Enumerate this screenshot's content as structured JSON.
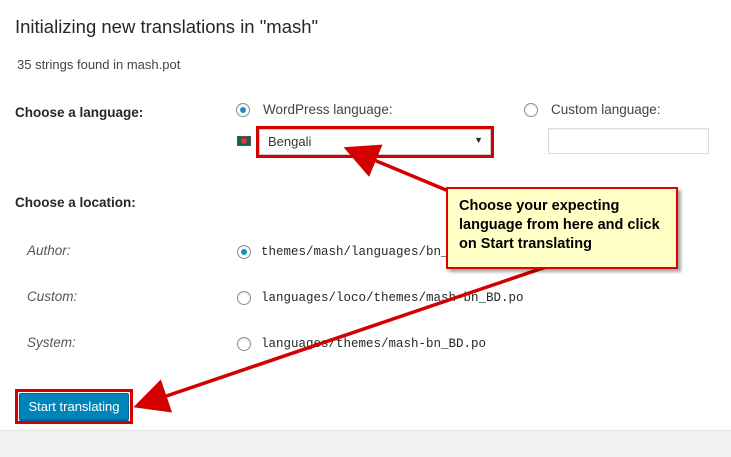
{
  "header": {
    "title": "Initializing new translations in \"mash\"",
    "subtitle": "35 strings found in mash.pot"
  },
  "language": {
    "section_label": "Choose a language:",
    "wordpress_option": "WordPress language:",
    "custom_option": "Custom language:",
    "selected_language": "Bengali",
    "flag_icon": "bangladesh-flag-icon",
    "custom_value": ""
  },
  "location": {
    "section_label": "Choose a location:",
    "options": [
      {
        "label": "Author:",
        "path": "themes/mash/languages/bn_B",
        "checked": true
      },
      {
        "label": "Custom:",
        "path": "languages/loco/themes/mash-bn_BD.po",
        "checked": false
      },
      {
        "label": "System:",
        "path": "languages/themes/mash-bn_BD.po",
        "checked": false
      }
    ]
  },
  "actions": {
    "start_label": "Start translating"
  },
  "annotation": {
    "callout_text": "Choose your expecting language from here and click on Start translating",
    "highlight_color": "#d40000",
    "callout_background": "#ffffc6"
  },
  "colors": {
    "accent": "#0085ba",
    "radio_checked": "#1e8cbe"
  }
}
